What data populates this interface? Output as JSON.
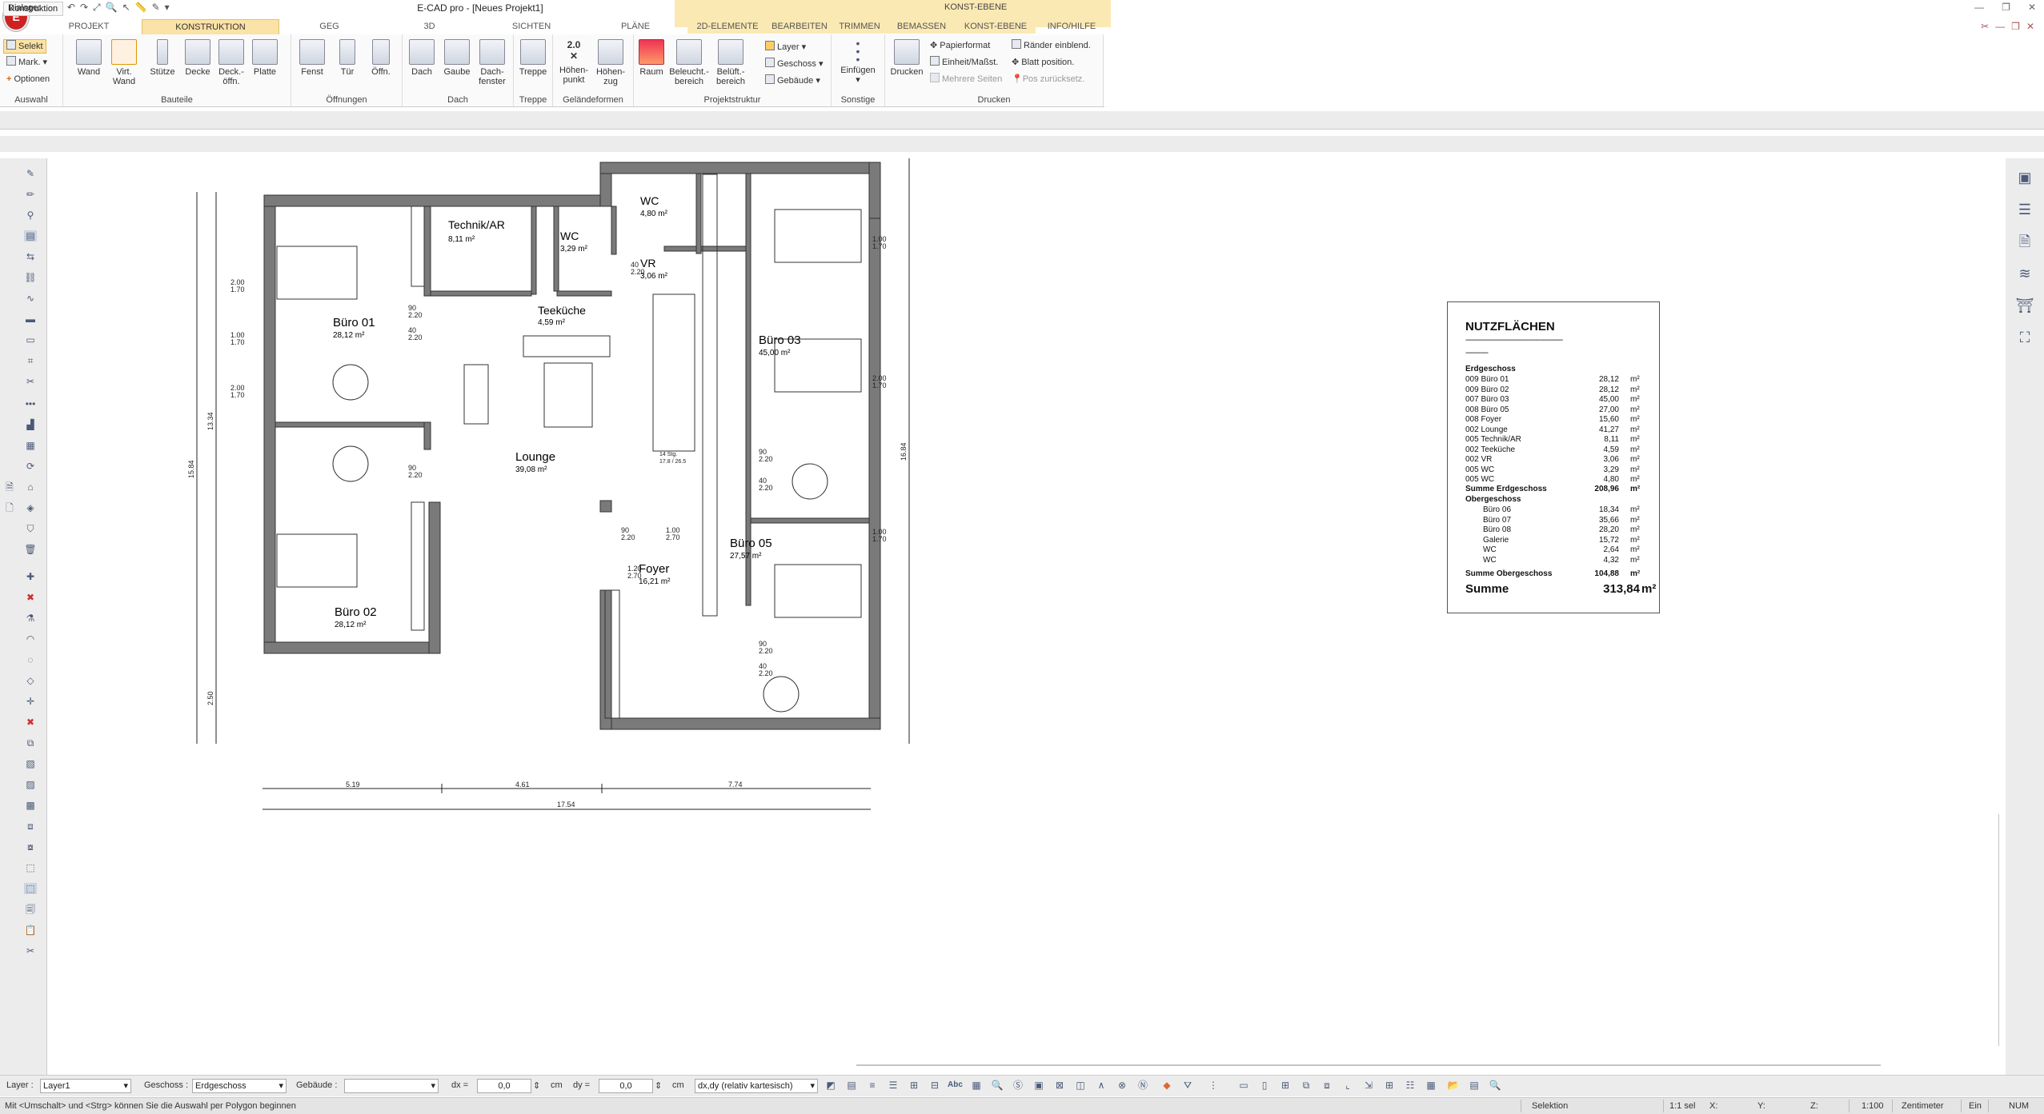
{
  "app": {
    "title": "E-CAD pro - [Neues Projekt1]",
    "logo": "E",
    "context_tab_label": "KONST-EBENE",
    "quick_access_icons": [
      "open-icon",
      "save-icon",
      "undo-icon",
      "redo-icon",
      "zoom-extents-icon",
      "zoom-icon",
      "select-icon",
      "measure-icon",
      "pen-icon"
    ]
  },
  "ribbon_tabs": [
    "PROJEKT",
    "KONSTRUKTION",
    "GEG",
    "3D",
    "SICHTEN",
    "PLÄNE",
    "2D-ELEMENTE",
    "BEARBEITEN",
    "TRIMMEN",
    "BEMASSEN",
    "KONST-EBENE",
    "INFO/HILFE"
  ],
  "ribbon_active_tab": "KONSTRUKTION",
  "ribbon": {
    "auswahl": {
      "label": "Auswahl",
      "selekt": "Selekt",
      "mark": "Mark.",
      "optionen": "Optionen"
    },
    "bauteile": {
      "label": "Bauteile",
      "items": [
        "Wand",
        "Virt.\nWand",
        "Stütze",
        "Decke",
        "Deck.-\nöffn.",
        "Platte"
      ]
    },
    "oeffnungen": {
      "label": "Öffnungen",
      "items": [
        "Fenst",
        "Tür",
        "Öffn."
      ]
    },
    "dach": {
      "label": "Dach",
      "items": [
        "Dach",
        "Gaube",
        "Dach-\nfenster"
      ]
    },
    "treppe": {
      "label": "Treppe",
      "items": [
        "Treppe"
      ]
    },
    "gelaende": {
      "label": "Geländeformen",
      "items": [
        "Höhen-\npunkt",
        "Höhen-\nzug"
      ],
      "badge": "2.0"
    },
    "projektstruktur": {
      "label": "Projektstruktur",
      "items": [
        "Raum",
        "Beleucht.-\nbereich",
        "Belüft.-\nbereich"
      ],
      "small": [
        "Layer",
        "Geschoss",
        "Gebäude"
      ]
    },
    "sonstige": {
      "label": "Sonstige",
      "items": [
        "Einfügen"
      ]
    },
    "drucken": {
      "label": "Drucken",
      "items": [
        "Drucken"
      ],
      "small": [
        "Papierformat",
        "Einheit/Maßst.",
        "Mehrere Seiten",
        "Ränder einblend.",
        "Blatt position.",
        "Pos zurücksetz."
      ]
    }
  },
  "panel": {
    "tab": "Konstruktion",
    "dialoge": "Dialoge:"
  },
  "plan": {
    "rooms": [
      {
        "name": "Technik/AR",
        "area": "8,11 m²"
      },
      {
        "name": "WC",
        "area": "3,29 m²"
      },
      {
        "name": "WC",
        "area": "4,80 m²"
      },
      {
        "name": "VR",
        "area": "3,06 m²"
      },
      {
        "name": "Teeküche",
        "area": "4,59 m²"
      },
      {
        "name": "Büro 01",
        "area": "28,12 m²"
      },
      {
        "name": "Büro 03",
        "area": "45,00 m²"
      },
      {
        "name": "Lounge",
        "area": "39,08 m²"
      },
      {
        "name": "Büro 05",
        "area": "27,57 m²"
      },
      {
        "name": "Foyer",
        "area": "16,21 m²"
      },
      {
        "name": "Büro 02",
        "area": "28,12 m²"
      }
    ],
    "dims_bottom": [
      "5.19",
      "4.61",
      "7.74"
    ],
    "dim_total": "17.54",
    "dims_left": [
      "15.84",
      "13.34",
      "2.50"
    ],
    "dim_right": "16.84",
    "window_labels": [
      "2.00",
      "1.70",
      "1.00",
      "1.70",
      "2.00",
      "1.70",
      "1.00",
      "1.70",
      "2.00",
      "1.70",
      "1.00",
      "1.70"
    ],
    "door_labels": [
      "90",
      "2.20",
      "40",
      "2.20",
      "90",
      "2.20",
      "40",
      "2.20",
      "90",
      "2.20",
      "1.00",
      "2.70",
      "1.20",
      "2.70",
      "90",
      "2.20",
      "40",
      "2.20",
      "90",
      "2.20",
      "40",
      "2.20"
    ],
    "stair_label": "14 Stg.",
    "stair_sub": "17.8 / 26.5"
  },
  "nutzflaechen": {
    "title": "NUTZFLÄCHEN",
    "sections": [
      {
        "heading": "Erdgeschoss",
        "rows": [
          {
            "name": "009 Büro 01",
            "value": "28,12",
            "unit": "m²"
          },
          {
            "name": "009 Büro 02",
            "value": "28,12",
            "unit": "m²"
          },
          {
            "name": "007 Büro 03",
            "value": "45,00",
            "unit": "m²"
          },
          {
            "name": "008 Büro 05",
            "value": "27,00",
            "unit": "m²"
          },
          {
            "name": "008 Foyer",
            "value": "15,60",
            "unit": "m²"
          },
          {
            "name": "002 Lounge",
            "value": "41,27",
            "unit": "m²"
          },
          {
            "name": "005 Technik/AR",
            "value": "8,11",
            "unit": "m²"
          },
          {
            "name": "002 Teeküche",
            "value": "4,59",
            "unit": "m²"
          },
          {
            "name": "002 VR",
            "value": "3,06",
            "unit": "m²"
          },
          {
            "name": "005 WC",
            "value": "3,29",
            "unit": "m²"
          },
          {
            "name": "005 WC",
            "value": "4,80",
            "unit": "m²"
          }
        ],
        "sum_label": "Summe Erdgeschoss",
        "sum_value": "208,96",
        "sum_unit": "m²"
      },
      {
        "heading": "Obergeschoss",
        "rows": [
          {
            "name": "Büro 06",
            "value": "18,34",
            "unit": "m²"
          },
          {
            "name": "Büro 07",
            "value": "35,66",
            "unit": "m²"
          },
          {
            "name": "Büro 08",
            "value": "28,20",
            "unit": "m²"
          },
          {
            "name": "Galerie",
            "value": "15,72",
            "unit": "m²"
          },
          {
            "name": "WC",
            "value": "2,64",
            "unit": "m²"
          },
          {
            "name": "WC",
            "value": "4,32",
            "unit": "m²"
          }
        ],
        "sum_label": "Summe Obergeschoss",
        "sum_value": "104,88",
        "sum_unit": "m²"
      }
    ],
    "total_label": "Summe",
    "total_value": "313,84",
    "total_unit": "m²"
  },
  "inputbar": {
    "layer_label": "Layer :",
    "layer_value": "Layer1",
    "geschoss_label": "Geschoss :",
    "geschoss_value": "Erdgeschoss",
    "gebaeude_label": "Gebäude :",
    "gebaeude_value": "",
    "dx_label": "dx =",
    "dx_value": "0,0",
    "dx_unit": "cm",
    "dy_label": "dy =",
    "dy_value": "0,0",
    "dy_unit": "cm",
    "mode_value": "dx,dy (relativ kartesisch)",
    "text_icon_label": "Abc"
  },
  "statusbar": {
    "message": "Mit <Umschalt> und <Strg> können Sie die Auswahl per Polygon beginnen",
    "mode": "Selektion",
    "sel": "1:1 sel",
    "x": "X:",
    "y": "Y:",
    "z": "Z:",
    "scale": "1:100",
    "unit": "Zentimeter",
    "ein": "Ein",
    "num": "NUM"
  }
}
